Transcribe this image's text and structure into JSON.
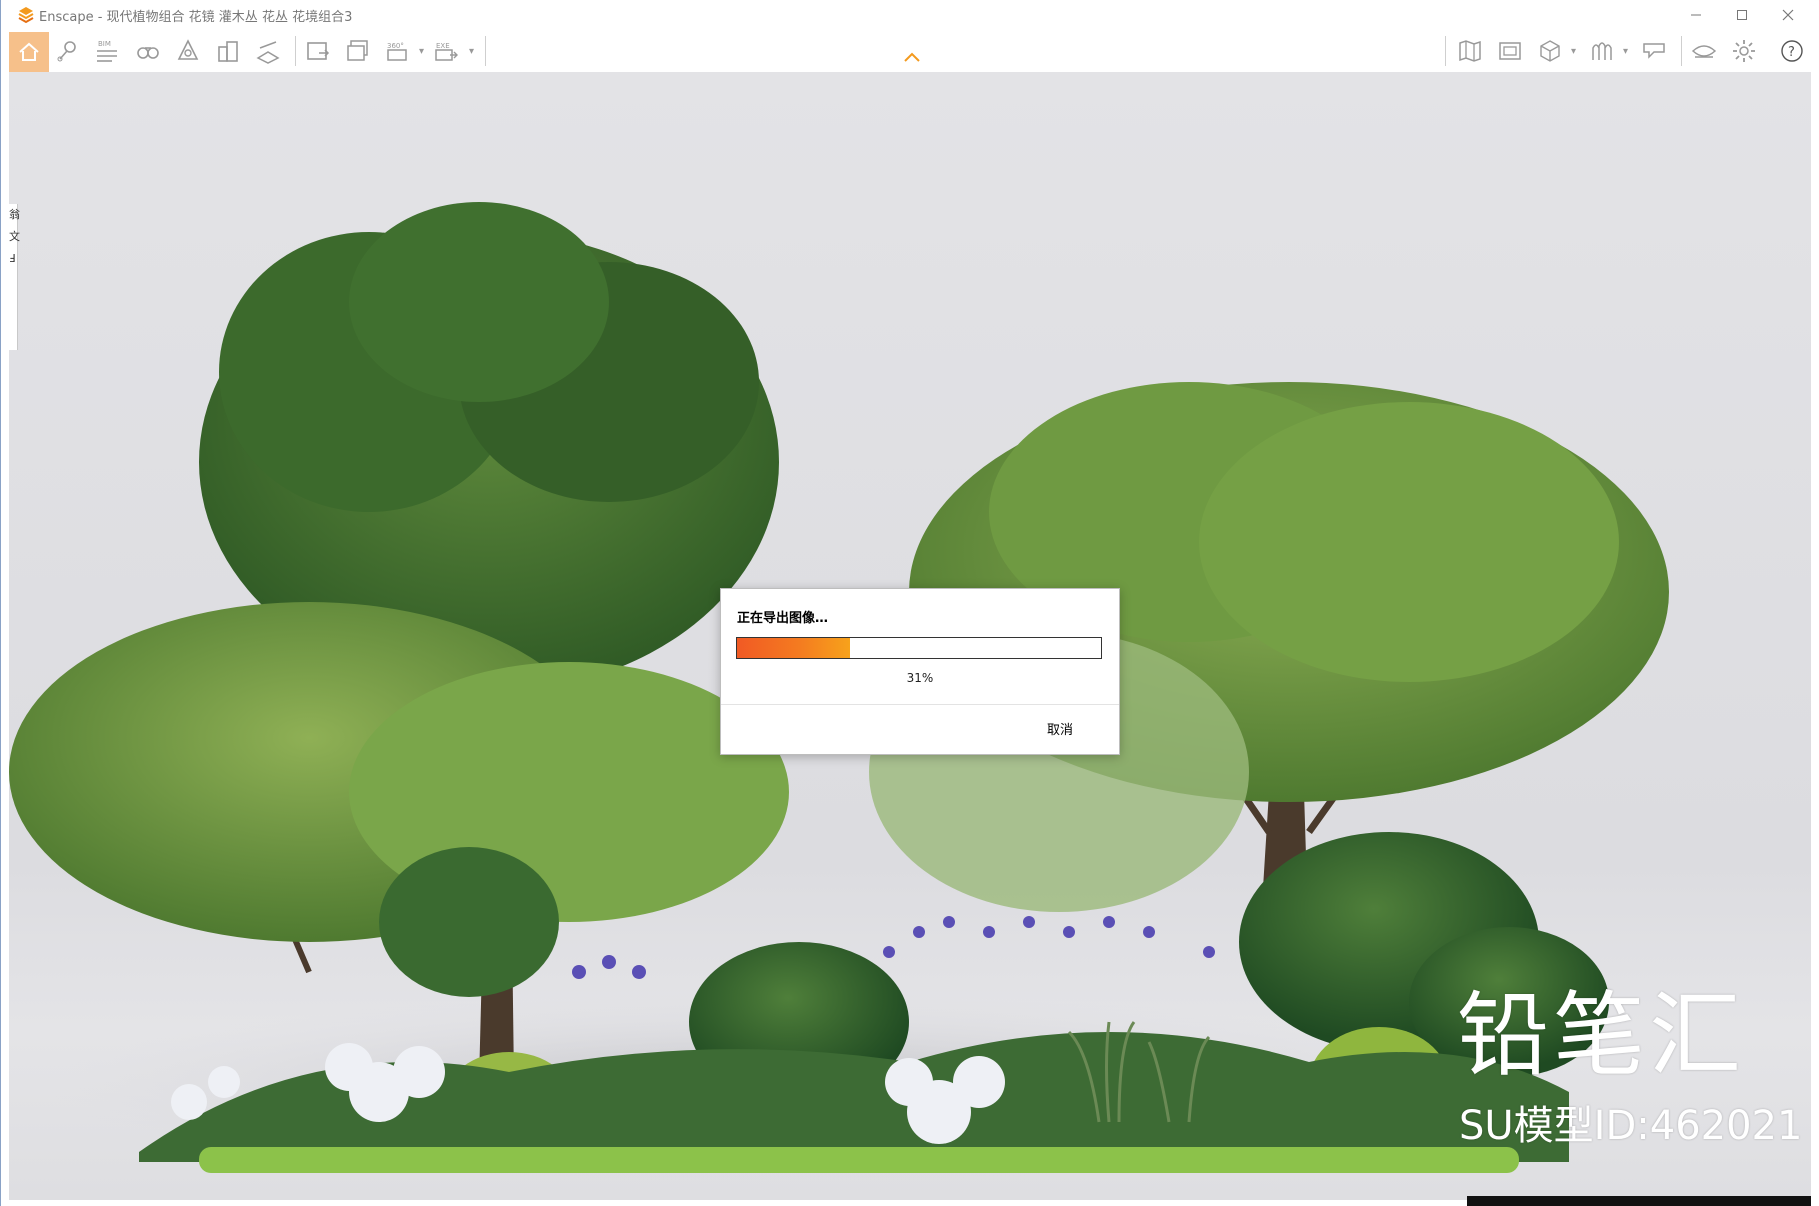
{
  "window": {
    "app_name": "Enscape",
    "title": "Enscape - 现代植物组合 花镜 灌木丛 花丛 花境组合3",
    "controls": [
      "minimize",
      "maximize",
      "close"
    ]
  },
  "toolbar": {
    "left_tools": [
      {
        "name": "home-icon"
      },
      {
        "name": "map-pin-icon"
      },
      {
        "name": "bim-list-icon",
        "label": "BIM"
      },
      {
        "name": "binoculars-icon"
      },
      {
        "name": "atmosphere-icon"
      },
      {
        "name": "buildings-icon"
      },
      {
        "name": "section-icon"
      },
      {
        "name": "screenshot-export-icon"
      },
      {
        "name": "batch-render-icon"
      },
      {
        "name": "panorama-360-icon",
        "label": "360°"
      },
      {
        "name": "exe-export-icon",
        "label": "EXE"
      }
    ],
    "right_tools": [
      {
        "name": "map-icon"
      },
      {
        "name": "video-editor-icon"
      },
      {
        "name": "cube-view-icon"
      },
      {
        "name": "asset-library-icon"
      },
      {
        "name": "collaboration-icon"
      },
      {
        "name": "visibility-icon"
      },
      {
        "name": "settings-gear-icon"
      },
      {
        "name": "help-icon"
      }
    ]
  },
  "side_panel": {
    "chars": [
      "翁",
      "文",
      "Ⅎ"
    ]
  },
  "dialog": {
    "title": "正在导出图像…",
    "progress": 0.31,
    "progress_text": "31%",
    "cancel_label": "取消"
  },
  "watermark": {
    "brand": "铅笔汇",
    "model_id": "SU模型ID:462021"
  },
  "colors": {
    "accent_orange": "#f47b20",
    "home_highlight": "#f6c08a",
    "viewport_bg": "#dcdce0"
  }
}
